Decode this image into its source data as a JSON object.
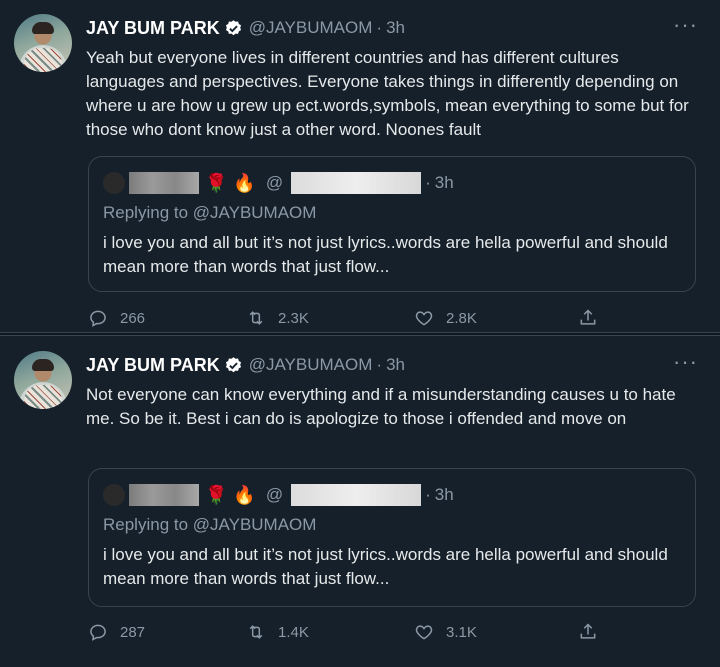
{
  "tweets": [
    {
      "name": "JAY BUM PARK",
      "handle": "@JAYBUMAOM",
      "dot": "·",
      "time": "3h",
      "more": "···",
      "text": "Yeah but everyone lives in different countries and has different cultures languages and perspectives. Everyone takes things in differently depending on where u are how u grew up ect.words,symbols, mean everything to some but for those who dont know just a other word. Noones fault",
      "quote": {
        "at": "@",
        "dot": "·",
        "time": "3h",
        "replying": "Replying to @JAYBUMAOM",
        "text": "i love you and all but it’s not just lyrics..words are hella powerful and should mean more than words that just flow..."
      },
      "stats": {
        "replies": "266",
        "retweets": "2.3K",
        "likes": "2.8K"
      }
    },
    {
      "name": "JAY BUM PARK",
      "handle": "@JAYBUMAOM",
      "dot": "·",
      "time": "3h",
      "more": "···",
      "text": "Not everyone can know everything and if a misunderstanding causes u to hate me. So be it. Best i can do is apologize to those i offended and move on",
      "quote": {
        "at": "@",
        "dot": "·",
        "time": "3h",
        "replying": "Replying to @JAYBUMAOM",
        "text": "i love you and all but it’s not just lyrics..words are hella powerful and should mean more than words that just flow..."
      },
      "stats": {
        "replies": "287",
        "retweets": "1.4K",
        "likes": "3.1K"
      }
    }
  ],
  "emoji": {
    "rose": "🌹",
    "fire": "🔥"
  },
  "icons": {
    "reply": "reply-icon",
    "retweet": "retweet-icon",
    "like": "heart-icon",
    "share": "share-icon",
    "verified": "verified-badge-icon"
  },
  "colors": {
    "background": "#15202b",
    "muted": "#8b98a5",
    "text": "#e6e9ea"
  }
}
